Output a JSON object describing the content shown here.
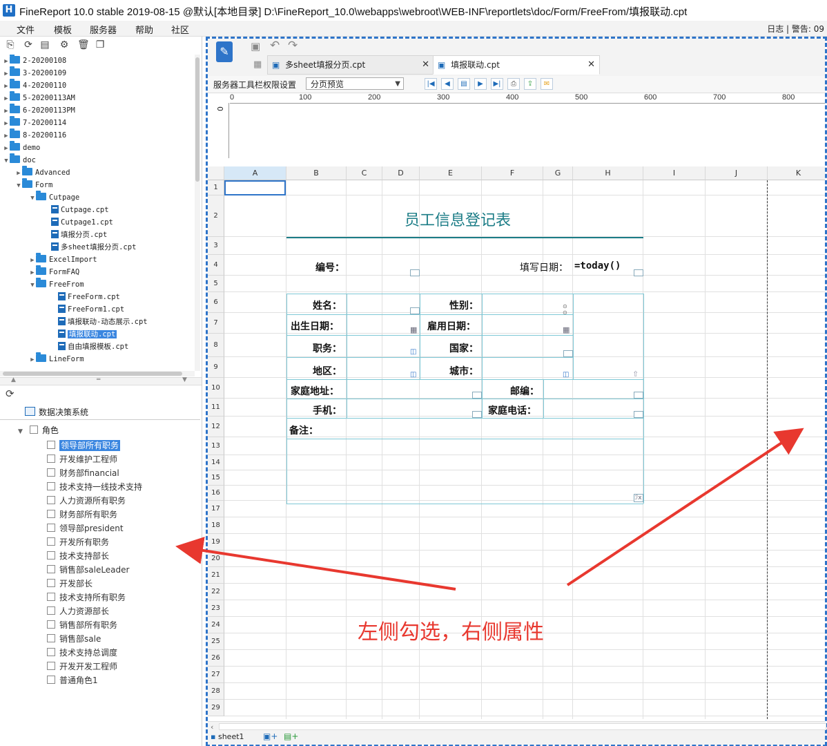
{
  "window": {
    "title": "FineReport 10.0 stable 2019-08-15 @默认[本地目录]    D:\\FineReport_10.0\\webapps\\webroot\\WEB-INF\\reportlets\\doc/Form/FreeFrom/填报联动.cpt",
    "logo_letter": "H"
  },
  "menubar": {
    "items": [
      "文件",
      "模板",
      "服务器",
      "帮助",
      "社区"
    ],
    "right": "日志  |  警告: 09"
  },
  "tree": {
    "items": [
      {
        "label": "2-20200108"
      },
      {
        "label": "3-20200109"
      },
      {
        "label": "4-20200110"
      },
      {
        "label": "5-20200113AM"
      },
      {
        "label": "6-20200113PM"
      },
      {
        "label": "7-20200114"
      },
      {
        "label": "8-20200116"
      },
      {
        "label": "demo"
      },
      {
        "label": "doc"
      },
      {
        "label": "Advanced"
      },
      {
        "label": "Form"
      },
      {
        "label": "Cutpage"
      },
      {
        "label": "Cutpage.cpt"
      },
      {
        "label": "Cutpage1.cpt"
      },
      {
        "label": "填报分页.cpt"
      },
      {
        "label": "多sheet填报分页.cpt"
      },
      {
        "label": "ExcelImport"
      },
      {
        "label": "FormFAQ"
      },
      {
        "label": "FreeFrom"
      },
      {
        "label": "FreeForm.cpt"
      },
      {
        "label": "FreeForm1.cpt"
      },
      {
        "label": "填报联动-动态展示.cpt"
      },
      {
        "label": "填报联动.cpt"
      },
      {
        "label": "自由填报模板.cpt"
      },
      {
        "label": "LineForm"
      }
    ]
  },
  "rolepanel": {
    "system": "数据决策系统",
    "root": "角色",
    "roles": [
      "领导部所有职务",
      "开发维护工程师",
      "财务部financial",
      "技术支持一线技术支持",
      "人力资源所有职务",
      "财务部所有职务",
      "领导部president",
      "开发所有职务",
      "技术支持部长",
      "销售部saleLeader",
      "开发部长",
      "技术支持所有职务",
      "人力资源部长",
      "销售部所有职务",
      "销售部sale",
      "技术支持总调度",
      "开发开发工程师",
      "普通角色1"
    ]
  },
  "tabs": [
    {
      "label": "多sheet填报分页.cpt",
      "active": false
    },
    {
      "label": "填报联动.cpt",
      "active": true
    }
  ],
  "toolbar2": {
    "label": "服务器工具栏权限设置",
    "select_value": "分页预览"
  },
  "ruler": [
    "0",
    "100",
    "200",
    "300",
    "400",
    "500",
    "600",
    "700",
    "800"
  ],
  "vruler": "0",
  "columns": [
    "A",
    "B",
    "C",
    "D",
    "E",
    "F",
    "G",
    "H",
    "I",
    "J",
    "K"
  ],
  "rows": [
    "1",
    "2",
    "3",
    "4",
    "5",
    "6",
    "7",
    "8",
    "9",
    "10",
    "11",
    "12",
    "13",
    "14",
    "15",
    "16",
    "17",
    "18",
    "19",
    "20",
    "21",
    "22",
    "23",
    "24",
    "25",
    "26",
    "27",
    "28",
    "29"
  ],
  "form": {
    "title": "员工信息登记表",
    "bianhao": "编号：",
    "date_label": "填写日期：",
    "date_formula": "=today()",
    "name": "姓名：",
    "gender": "性别：",
    "birth": "出生日期：",
    "hire": "雇用日期：",
    "job": "职务：",
    "country": "国家：",
    "region": "地区：",
    "city": "城市：",
    "address": "家庭地址：",
    "zip": "邮编：",
    "mobile": "手机：",
    "homephone": "家庭电话：",
    "note": "备注："
  },
  "sheet": {
    "name": "sheet1"
  },
  "annotation": {
    "text": "左侧勾选，右侧属性",
    "color": "#e8382f"
  }
}
